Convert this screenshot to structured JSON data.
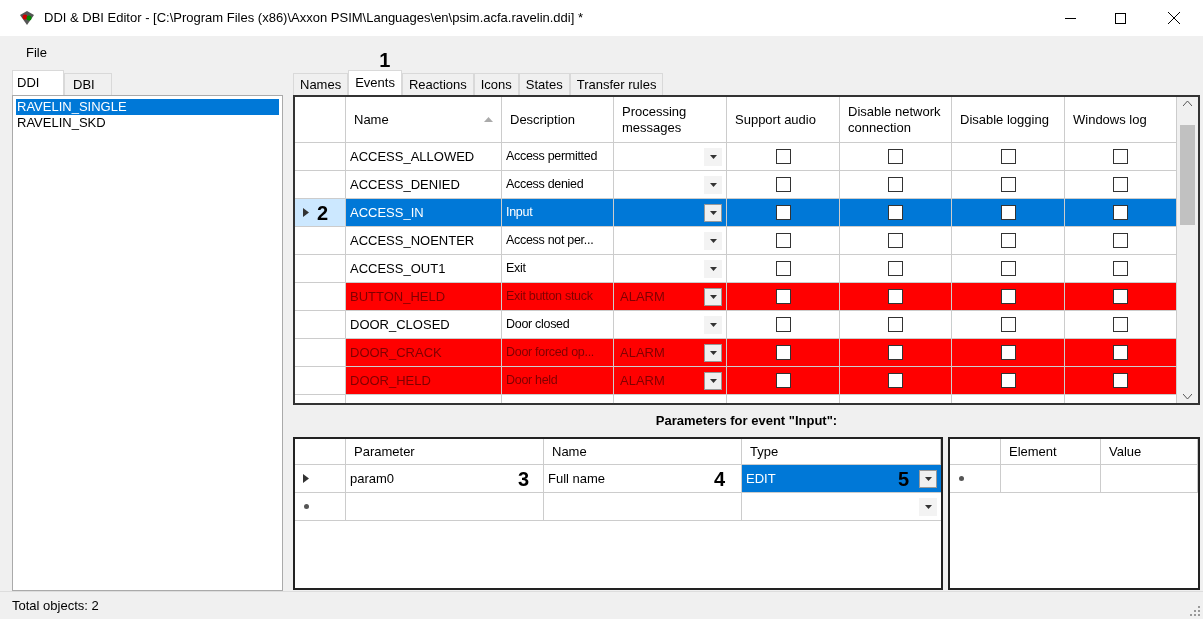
{
  "window": {
    "title": "DDI & DBI Editor - [C:\\Program Files (x86)\\Axxon PSIM\\Languages\\en\\psim.acfa.ravelin.ddi] *"
  },
  "menu": [
    "File"
  ],
  "left_tabs": [
    {
      "label": "DDI",
      "selected": true
    },
    {
      "label": "DBI",
      "selected": false
    }
  ],
  "objects": [
    {
      "label": "RAVELIN_SINGLE",
      "selected": true
    },
    {
      "label": "RAVELIN_SKD",
      "selected": false
    }
  ],
  "tabs": [
    {
      "label": "Names",
      "selected": false
    },
    {
      "label": "Events",
      "selected": true,
      "callout": "1"
    },
    {
      "label": "Reactions",
      "selected": false
    },
    {
      "label": "Icons",
      "selected": false
    },
    {
      "label": "States",
      "selected": false
    },
    {
      "label": "Transfer rules",
      "selected": false
    }
  ],
  "events": {
    "columns": [
      "Name",
      "Description",
      "Processing messages",
      "Support audio",
      "Disable network connection",
      "Disable logging",
      "Windows log"
    ],
    "rows": [
      {
        "name": "ACCESS_ALLOWED",
        "description": "Access permitted",
        "processing": "",
        "kind": "normal",
        "selected": false,
        "checks": [
          {
            "checked": false
          },
          {
            "checked": false
          },
          {
            "checked": false
          },
          {
            "checked": false
          }
        ]
      },
      {
        "name": "ACCESS_DENIED",
        "description": "Access denied",
        "processing": "",
        "kind": "normal",
        "selected": false,
        "checks": [
          {
            "checked": false
          },
          {
            "checked": false
          },
          {
            "checked": false
          },
          {
            "checked": false
          }
        ]
      },
      {
        "name": "ACCESS_IN",
        "description": "Input",
        "processing": "",
        "kind": "normal",
        "selected": true,
        "callout": "2",
        "checks": [
          {
            "checked": false
          },
          {
            "checked": false
          },
          {
            "checked": false
          },
          {
            "checked": false
          }
        ]
      },
      {
        "name": "ACCESS_NOENTER",
        "description": "Access not per...",
        "processing": "",
        "kind": "normal",
        "selected": false,
        "checks": [
          {
            "checked": false
          },
          {
            "checked": false
          },
          {
            "checked": false
          },
          {
            "checked": false
          }
        ]
      },
      {
        "name": "ACCESS_OUT1",
        "description": "Exit",
        "processing": "",
        "kind": "normal",
        "selected": false,
        "checks": [
          {
            "checked": false
          },
          {
            "checked": false
          },
          {
            "checked": false
          },
          {
            "checked": false
          }
        ]
      },
      {
        "name": "BUTTON_HELD",
        "description": "Exit button stuck",
        "processing": "ALARM",
        "kind": "alarm",
        "selected": false,
        "checks": [
          {
            "checked": false
          },
          {
            "checked": false
          },
          {
            "checked": false
          },
          {
            "checked": false
          }
        ]
      },
      {
        "name": "DOOR_CLOSED",
        "description": "Door closed",
        "processing": "",
        "kind": "normal",
        "selected": false,
        "checks": [
          {
            "checked": false
          },
          {
            "checked": false
          },
          {
            "checked": false
          },
          {
            "checked": false
          }
        ]
      },
      {
        "name": "DOOR_CRACK",
        "description": "Door forced op...",
        "processing": "ALARM",
        "kind": "alarm",
        "selected": false,
        "checks": [
          {
            "checked": false
          },
          {
            "checked": false
          },
          {
            "checked": false
          },
          {
            "checked": false
          }
        ]
      },
      {
        "name": "DOOR_HELD",
        "description": "Door held",
        "processing": "ALARM",
        "kind": "alarm",
        "selected": false,
        "checks": [
          {
            "checked": false
          },
          {
            "checked": false
          },
          {
            "checked": false
          },
          {
            "checked": false
          }
        ]
      }
    ]
  },
  "parameters_title": "Parameters for event \"Input\":",
  "parameters": {
    "columns": [
      "Parameter",
      "Name",
      "Type"
    ],
    "rows": [
      {
        "parameter": "param0",
        "name": "Full name",
        "type": "EDIT",
        "type_selected": true,
        "callouts": [
          "3",
          "4",
          "5"
        ]
      }
    ]
  },
  "elements": {
    "columns": [
      "Element",
      "Value"
    ]
  },
  "status_bar": "Total objects: 2"
}
